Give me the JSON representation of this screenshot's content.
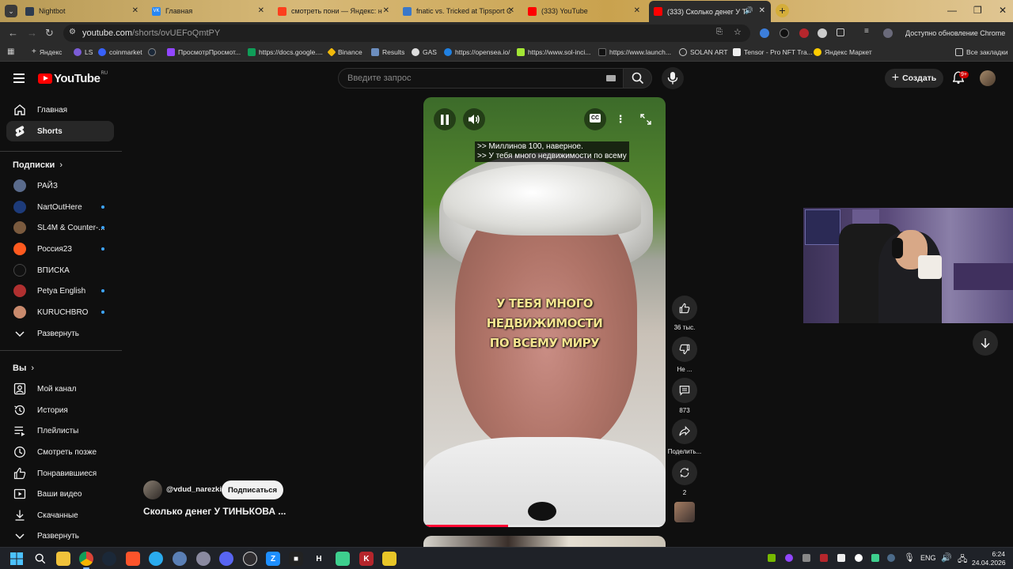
{
  "browser": {
    "tabs": [
      {
        "label": "Nightbot",
        "favicon_color": "#2d3b4f"
      },
      {
        "label": "Главная",
        "favicon_color": "#2787f5"
      },
      {
        "label": "смотреть пони — Яндекс: наш",
        "favicon_color": "#fc3f1d"
      },
      {
        "label": "fnatic vs. Tricked at Tipsport Co",
        "favicon_color": "#3a78c9"
      },
      {
        "label": "(333) YouTube",
        "favicon_color": "#ff0000"
      },
      {
        "label": "(333) Сколько денег У ТИН",
        "favicon_color": "#ff0000",
        "active": true
      }
    ],
    "url_host": "youtube.com",
    "url_path": "/shorts/ovUEFoQmtPY",
    "update_text": "Доступно обновление Chrome",
    "bookmarks": [
      {
        "label": "Яндекс",
        "color": "#fc3f1d"
      },
      {
        "label": "LS",
        "color": "#7b5cd6"
      },
      {
        "label": "coinmarket",
        "color": "#3861fb"
      },
      {
        "label": "",
        "color": "#1b2838"
      },
      {
        "label": "ПросмотрПросмот...",
        "color": "#9146ff"
      },
      {
        "label": "https://docs.google....",
        "color": "#0f9d58"
      },
      {
        "label": "Binance",
        "color": "#f0b90b"
      },
      {
        "label": "Results",
        "color": "#6c8ebf"
      },
      {
        "label": "GAS",
        "color": "#dddddd"
      },
      {
        "label": "https://opensea.io/",
        "color": "#2081e2"
      },
      {
        "label": "https://www.sol-inci...",
        "color": "#a3e635"
      },
      {
        "label": "https://www.launch...",
        "color": "#111111"
      },
      {
        "label": "SOLAN ART",
        "color": "#cccccc"
      },
      {
        "label": "Tensor - Pro NFT Tra...",
        "color": "#eeeeee"
      },
      {
        "label": "Яндекс Маркет",
        "color": "#ffcc00"
      }
    ],
    "all_bookmarks": "Все закладки"
  },
  "youtube": {
    "logo_text": "YouTube",
    "logo_region": "RU",
    "search_placeholder": "Введите запрос",
    "create_label": "Создать",
    "notif_badge": "9+"
  },
  "sidebar": {
    "main": [
      {
        "label": "Главная",
        "icon": "home-icon"
      },
      {
        "label": "Shorts",
        "icon": "shorts-icon",
        "active": true
      }
    ],
    "subs_header": "Подписки",
    "subscriptions": [
      {
        "label": "РАЙЗ",
        "color": "#5a6b8c",
        "dot": false
      },
      {
        "label": "NartOutHere",
        "color": "#1d3b7a",
        "dot": true
      },
      {
        "label": "SL4M & Counter-...",
        "color": "#7a5a3e",
        "dot": true
      },
      {
        "label": "Россия23",
        "color": "#ff5a1f",
        "dot": true
      },
      {
        "label": "ВПИСКА",
        "color": "#111111",
        "dot": false
      },
      {
        "label": "Petya English",
        "color": "#b03030",
        "dot": true
      },
      {
        "label": "KURUCHBRO",
        "color": "#c98a6d",
        "dot": true
      }
    ],
    "expand_label": "Развернуть",
    "you_header": "Вы",
    "you_items": [
      {
        "label": "Мой канал",
        "icon": "my-channel-icon"
      },
      {
        "label": "История",
        "icon": "history-icon"
      },
      {
        "label": "Плейлисты",
        "icon": "playlists-icon"
      },
      {
        "label": "Смотреть позже",
        "icon": "watch-later-icon"
      },
      {
        "label": "Понравившиеся",
        "icon": "liked-icon"
      },
      {
        "label": "Ваши видео",
        "icon": "your-videos-icon"
      },
      {
        "label": "Скачанные",
        "icon": "downloads-icon"
      }
    ],
    "expand2_label": "Развернуть"
  },
  "short": {
    "caption_line1": ">> Миллинов 100, наверное.",
    "caption_line2": ">> У тебя много недвижимости по всему",
    "burned_line1": "У ТЕБЯ МНОГО НЕДВИЖИМОСТИ",
    "burned_line2": "ПО ВСЕМУ МИРУ",
    "progress_fraction": 0.35,
    "channel": "@vdud_narezki",
    "subscribe_label": "Подписаться",
    "title": "Сколько денег У ТИНЬКОВА ..."
  },
  "actions": {
    "likes": "36 тыс.",
    "dislike": "Не ...",
    "comments": "873",
    "share": "Поделить...",
    "remix": "2"
  },
  "taskbar": {
    "lang": "ENG",
    "time": "6:24",
    "date": "24.04.2026"
  }
}
